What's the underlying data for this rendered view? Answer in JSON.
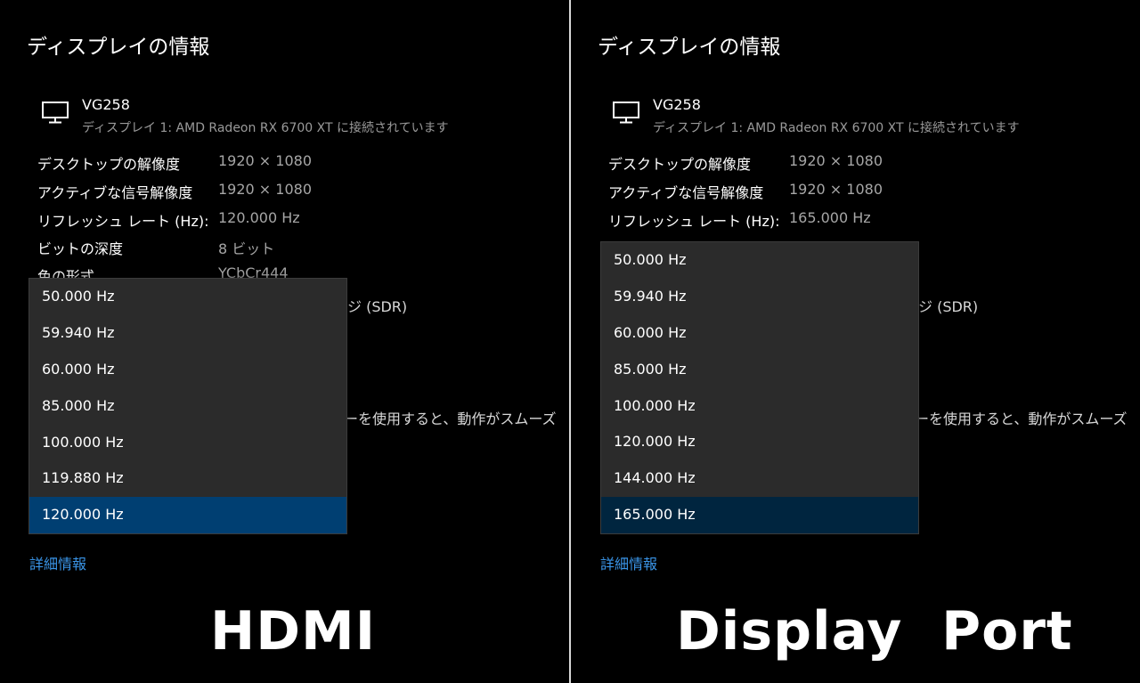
{
  "panels": [
    {
      "title": "ディスプレイの情報",
      "monitor_name": "VG258",
      "monitor_sub": "ディスプレイ 1: AMD Radeon RX 6700 XT に接続されています",
      "rows": [
        {
          "key": "デスクトップの解像度",
          "value": "1920 × 1080"
        },
        {
          "key": "アクティブな信号解像度",
          "value": "1920 × 1080"
        },
        {
          "key": "リフレッシュ レート (Hz):",
          "value": "120.000 Hz"
        },
        {
          "key": "ビットの深度",
          "value": "8 ビット"
        },
        {
          "key": "色の形式",
          "value": "YCbCr444"
        }
      ],
      "fragment_sdr": "ジ (SDR)",
      "fragment_smooth": "ーを使用すると、動作がスムーズ",
      "dropdown_options": [
        "50.000 Hz",
        "59.940 Hz",
        "60.000 Hz",
        "85.000 Hz",
        "100.000 Hz",
        "119.880 Hz",
        "120.000 Hz"
      ],
      "selected_option": "120.000 Hz",
      "link": "詳細情報",
      "label": "HDMI"
    },
    {
      "title": "ディスプレイの情報",
      "monitor_name": "VG258",
      "monitor_sub": "ディスプレイ 1: AMD Radeon RX 6700 XT に接続されています",
      "rows": [
        {
          "key": "デスクトップの解像度",
          "value": "1920 × 1080"
        },
        {
          "key": "アクティブな信号解像度",
          "value": "1920 × 1080"
        },
        {
          "key": "リフレッシュ レート (Hz):",
          "value": "165.000 Hz"
        }
      ],
      "fragment_sdr": "ジ (SDR)",
      "fragment_smooth": "ーを使用すると、動作がスムーズ",
      "dropdown_options": [
        "50.000 Hz",
        "59.940 Hz",
        "60.000 Hz",
        "85.000 Hz",
        "100.000 Hz",
        "120.000 Hz",
        "144.000 Hz",
        "165.000 Hz"
      ],
      "selected_option": "165.000 Hz",
      "link": "詳細情報",
      "label": "Display  Port"
    }
  ],
  "colors": {
    "background": "#000000",
    "dropdown_bg": "#2b2b2b",
    "selected_hdmi": "#003f72",
    "selected_dp": "#00253f",
    "link": "#3a95e8",
    "value_text": "#a6a6a6"
  },
  "icons": {
    "monitor": "monitor-icon"
  }
}
